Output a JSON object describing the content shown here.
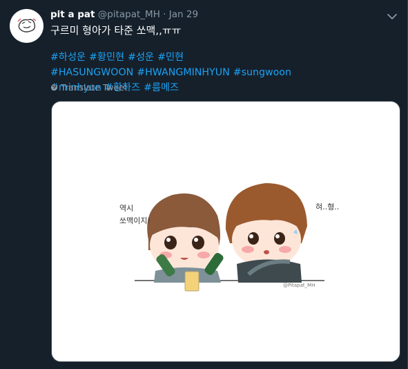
{
  "tweet": {
    "display_name": "pit a pat",
    "handle": "@pitapat_MH",
    "separator": "·",
    "date": "Jan 29",
    "text": "구르미 형아가 타준 쏘맥,,ㅠㅠ",
    "hashtags": [
      "#하성운",
      "#황민현",
      "#성운",
      "#민현",
      "#HASUNGWOON",
      "#HWANGMINHYUN",
      "#sungwoon",
      "#minhyun",
      "#황하즈",
      "#름메즈"
    ],
    "translate_label": "Translate Tweet"
  },
  "media": {
    "left_speech": [
      "역시",
      "쏘맥이지!"
    ],
    "right_speech": "혀..형..",
    "signature": "@Pitapat_MH"
  },
  "colors": {
    "background": "#15202b",
    "link": "#1da1f2",
    "muted": "#8899a6"
  },
  "icons": [
    "avatar-sketch",
    "chevron-down-icon",
    "globe-icon"
  ]
}
